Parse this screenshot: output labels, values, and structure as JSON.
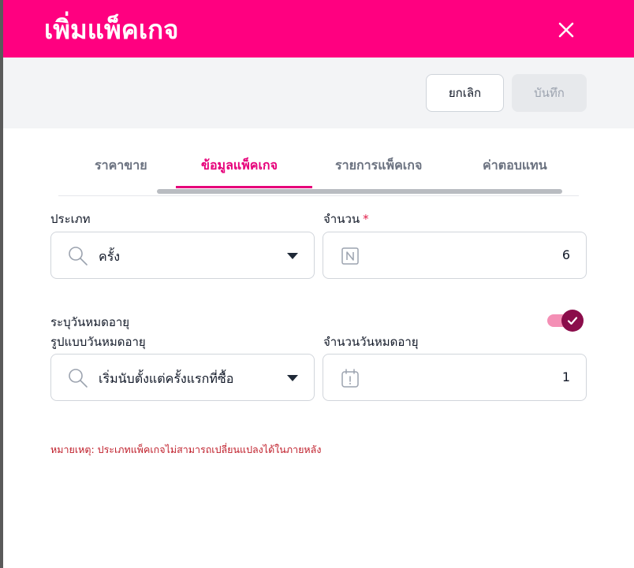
{
  "dialog": {
    "title": "เพิ่มแพ็คเกจ"
  },
  "toolbar": {
    "cancel_label": "ยกเลิก",
    "save_label": "บันทึก"
  },
  "tabs": [
    {
      "label": "ราคาขาย",
      "active": false
    },
    {
      "label": "ข้อมูลแพ็คเกจ",
      "active": true
    },
    {
      "label": "รายการแพ็คเกจ",
      "active": false
    },
    {
      "label": "ค่าตอบแทน",
      "active": false
    }
  ],
  "form": {
    "type": {
      "label": "ประเภท",
      "value": "ครั้ง",
      "icon": "search-icon"
    },
    "quantity": {
      "label": "จำนวน",
      "required_mark": "*",
      "value": "6",
      "icon": "number-icon"
    },
    "expiry_toggle": {
      "label": "ระบุวันหมดอายุ",
      "checked": true
    },
    "expiry_type": {
      "label": "รูปแบบวันหมดอายุ",
      "value": "เริ่มนับตั้งแต่ครั้งแรกที่ซื้อ",
      "icon": "search-icon"
    },
    "expiry_days": {
      "label": "จำนวนวันหมดอายุ",
      "value": "1",
      "icon": "calendar-alert-icon"
    },
    "note": "หมายเหตุ: ประเภทแพ็คเกจไม่สามารถเปลี่ยนแปลงได้ในภายหลัง"
  },
  "colors": {
    "brand": "#ff0080",
    "tab_active": "#e6007a",
    "toggle_on": "#8b0d4b",
    "note": "#c0202c"
  }
}
